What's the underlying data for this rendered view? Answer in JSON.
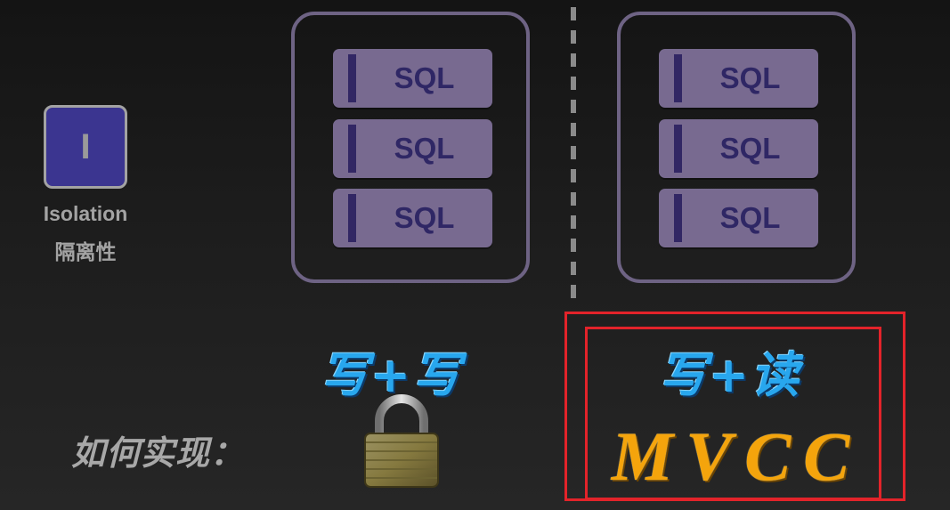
{
  "isolation": {
    "letter": "I",
    "en": "Isolation",
    "cn": "隔离性"
  },
  "transactions": {
    "left": [
      "SQL",
      "SQL",
      "SQL"
    ],
    "right": [
      "SQL",
      "SQL",
      "SQL"
    ]
  },
  "ops": {
    "left": "写+写",
    "right": "写+读"
  },
  "how": {
    "label": "如何实现："
  },
  "mvcc": {
    "label": "MVCC"
  },
  "colors": {
    "accent_blue": "#28a7ee",
    "mvcc_gold": "#f4a40c",
    "highlight_red": "#e3232a",
    "sql_block": "#786a90",
    "isolation_box": "#3b3590"
  }
}
